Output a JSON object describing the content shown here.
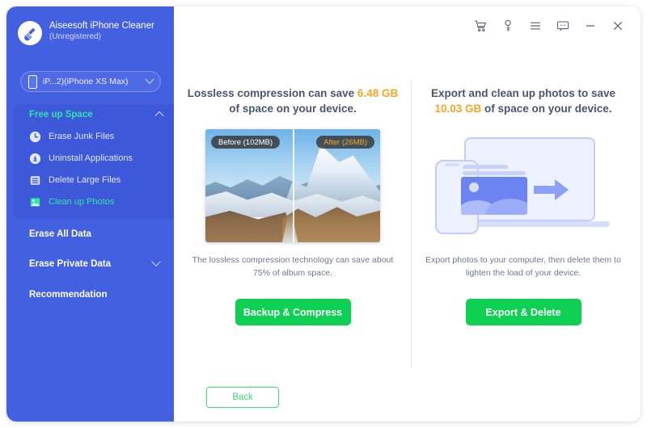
{
  "app": {
    "name": "Aiseesoft iPhone Cleaner",
    "name_line1": "Aiseesoft iPhone",
    "name_line2": "Cleaner",
    "registration": "(Unregistered)",
    "logo_icon": "broom-icon"
  },
  "device_selector": {
    "label": "iP...2)(iPhone XS Max)",
    "icon": "phone-icon",
    "chevron": "chevron-down-icon"
  },
  "titlebar": {
    "buttons": [
      {
        "name": "cart-icon",
        "label": "Cart"
      },
      {
        "name": "key-icon",
        "label": "Register"
      },
      {
        "name": "menu-icon",
        "label": "Menu"
      },
      {
        "name": "feedback-icon",
        "label": "Feedback"
      },
      {
        "name": "minimize-icon",
        "label": "Minimize"
      },
      {
        "name": "close-icon",
        "label": "Close"
      }
    ]
  },
  "sidebar": {
    "group": {
      "label": "Free up Space",
      "expanded": true,
      "chevron": "chevron-up-icon",
      "items": [
        {
          "label": "Erase Junk Files",
          "icon": "clock-icon",
          "active": false
        },
        {
          "label": "Uninstall Applications",
          "icon": "rocket-icon",
          "active": false
        },
        {
          "label": "Delete Large Files",
          "icon": "files-icon",
          "active": false
        },
        {
          "label": "Clean up Photos",
          "icon": "photo-icon",
          "active": true
        }
      ]
    },
    "sections": [
      {
        "label": "Erase All Data",
        "chevron": false
      },
      {
        "label": "Erase Private Data",
        "chevron": true
      },
      {
        "label": "Recommendation",
        "chevron": false
      }
    ]
  },
  "main": {
    "left_panel": {
      "title_pre": "Lossless compression can save",
      "title_amount": "6.48 GB",
      "title_post": "of space on your device.",
      "before_tag": "Before (102MB)",
      "after_tag": "After (26MB)",
      "description": "The lossless compression technology can save about 75% of album space.",
      "cta_label": "Backup & Compress"
    },
    "right_panel": {
      "title_pre": "Export and clean up photos to save",
      "title_amount": "10.03 GB",
      "title_post": "of space on your device.",
      "description": "Export photos to your computer, then delete them to lighten the load of your device.",
      "cta_label": "Export & Delete"
    },
    "back_label": "Back"
  },
  "colors": {
    "sidebar": "#4360e0",
    "sidebar_panel": "#3d58d8",
    "accent_green": "#2ce6a4",
    "cta_green": "#0ed154",
    "amount_orange": "#f5a623",
    "back_border": "#3bdb78"
  }
}
